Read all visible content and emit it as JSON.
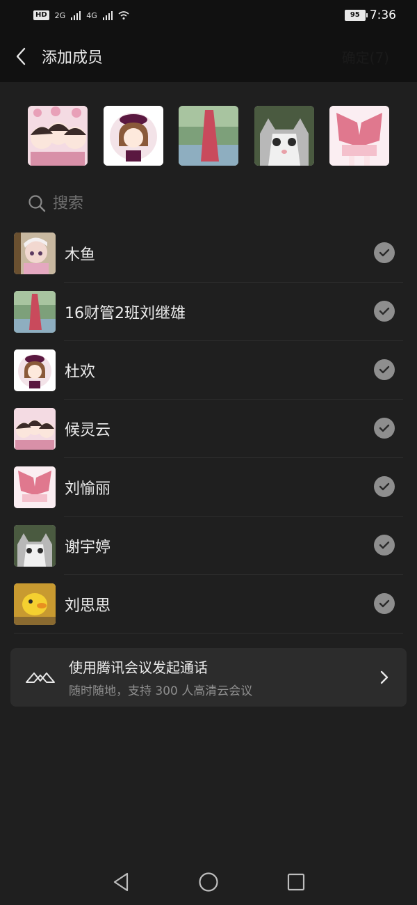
{
  "status_bar": {
    "hd_label": "HD",
    "net1": "2G",
    "net2": "4G",
    "battery": "95",
    "time": "7:36"
  },
  "header": {
    "title": "添加成员",
    "confirm_label": "确定(7)"
  },
  "search": {
    "placeholder": "搜索"
  },
  "contacts": [
    {
      "name": "木鱼",
      "selected": true
    },
    {
      "name": "16财管2班刘继雄",
      "selected": true
    },
    {
      "name": "杜欢",
      "selected": true
    },
    {
      "name": "候灵云",
      "selected": true
    },
    {
      "name": "刘愉丽",
      "selected": true
    },
    {
      "name": "谢宇婷",
      "selected": true
    },
    {
      "name": "刘思思",
      "selected": true
    }
  ],
  "meeting_card": {
    "title": "使用腾讯会议发起通话",
    "subtitle": "随时随地，支持 300 人高清云会议"
  },
  "colors": {
    "background": "#1f1f1f",
    "topbar": "#111111",
    "card": "#2c2c2c",
    "check": "#8e8e8e"
  }
}
